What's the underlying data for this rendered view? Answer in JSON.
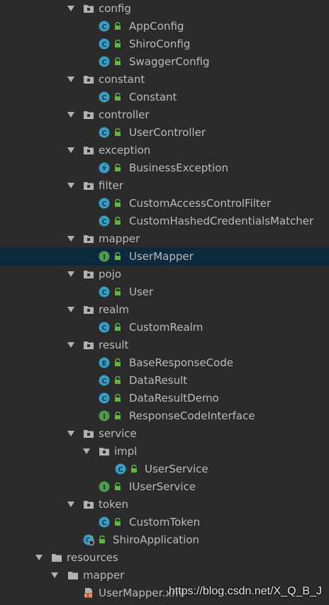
{
  "colors": {
    "background": "#2b2b2b",
    "text": "#bbbbbb",
    "selected_row": "#0d293e",
    "class_icon": "#3a9ec4",
    "interface_icon": "#4f9a4f",
    "lock": "#62b543"
  },
  "items": [
    {
      "label": "config",
      "icon": "package-folder-icon",
      "expanded": true
    },
    {
      "label": "AppConfig",
      "icon": "class-icon"
    },
    {
      "label": "ShiroConfig",
      "icon": "class-icon"
    },
    {
      "label": "SwaggerConfig",
      "icon": "class-icon"
    },
    {
      "label": "constant",
      "icon": "package-folder-icon",
      "expanded": true
    },
    {
      "label": "Constant",
      "icon": "class-icon"
    },
    {
      "label": "controller",
      "icon": "package-folder-icon",
      "expanded": true
    },
    {
      "label": "UserController",
      "icon": "class-icon"
    },
    {
      "label": "exception",
      "icon": "package-folder-icon",
      "expanded": true
    },
    {
      "label": "BusinessException",
      "icon": "exception-class-icon"
    },
    {
      "label": "filter",
      "icon": "package-folder-icon",
      "expanded": true
    },
    {
      "label": "CustomAccessControlFilter",
      "icon": "class-icon"
    },
    {
      "label": "CustomHashedCredentialsMatcher",
      "icon": "class-icon"
    },
    {
      "label": "mapper",
      "icon": "package-folder-icon",
      "expanded": true
    },
    {
      "label": "UserMapper",
      "icon": "interface-icon",
      "selected": true
    },
    {
      "label": "pojo",
      "icon": "package-folder-icon",
      "expanded": true
    },
    {
      "label": "User",
      "icon": "class-icon"
    },
    {
      "label": "realm",
      "icon": "package-folder-icon",
      "expanded": true
    },
    {
      "label": "CustomRealm",
      "icon": "class-icon"
    },
    {
      "label": "result",
      "icon": "package-folder-icon",
      "expanded": true
    },
    {
      "label": "BaseResponseCode",
      "icon": "enum-icon"
    },
    {
      "label": "DataResult",
      "icon": "class-icon"
    },
    {
      "label": "DataResultDemo",
      "icon": "class-icon"
    },
    {
      "label": "ResponseCodeInterface",
      "icon": "interface-icon"
    },
    {
      "label": "service",
      "icon": "package-folder-icon",
      "expanded": true
    },
    {
      "label": "impl",
      "icon": "package-folder-icon",
      "expanded": true
    },
    {
      "label": "UserService",
      "icon": "class-icon"
    },
    {
      "label": "IUserService",
      "icon": "interface-icon"
    },
    {
      "label": "token",
      "icon": "package-folder-icon",
      "expanded": true
    },
    {
      "label": "CustomToken",
      "icon": "class-icon"
    },
    {
      "label": "ShiroApplication",
      "icon": "spring-boot-class-icon"
    },
    {
      "label": "resources",
      "icon": "resources-folder-icon",
      "expanded": true
    },
    {
      "label": "mapper",
      "icon": "folder-icon",
      "expanded": true
    },
    {
      "label": "UserMapper.xml",
      "icon": "xml-file-icon"
    }
  ],
  "watermark": "https://blog.csdn.net/X_Q_B_J"
}
